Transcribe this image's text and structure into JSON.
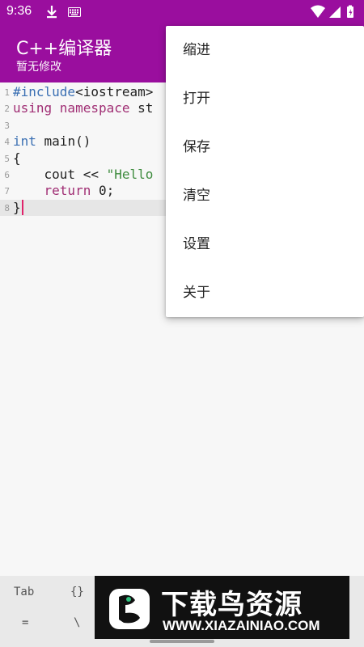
{
  "status_bar": {
    "time": "9:36",
    "icons": [
      "download-icon",
      "keyboard-icon",
      "wifi-icon",
      "cell-signal-icon",
      "battery-icon"
    ],
    "color": "#9a0e9e"
  },
  "app_bar": {
    "title": "C++编译器",
    "subtitle": "暂无修改"
  },
  "editor": {
    "lines": [
      {
        "num": "1",
        "parts": [
          {
            "t": "#include",
            "c": "kw-blue"
          },
          {
            "t": "<iostream>",
            "c": ""
          }
        ]
      },
      {
        "num": "2",
        "parts": [
          {
            "t": "using namespace",
            "c": "kw-purple"
          },
          {
            "t": " st",
            "c": ""
          }
        ]
      },
      {
        "num": "3",
        "parts": []
      },
      {
        "num": "4",
        "parts": [
          {
            "t": "int",
            "c": "kw-blue"
          },
          {
            "t": " main()",
            "c": ""
          }
        ]
      },
      {
        "num": "5",
        "parts": [
          {
            "t": "{",
            "c": ""
          }
        ]
      },
      {
        "num": "6",
        "parts": [
          {
            "t": "    cout << ",
            "c": ""
          },
          {
            "t": "\"Hello",
            "c": "str-green"
          }
        ]
      },
      {
        "num": "7",
        "parts": [
          {
            "t": "    ",
            "c": ""
          },
          {
            "t": "return",
            "c": "kw-purple"
          },
          {
            "t": " 0;",
            "c": ""
          }
        ]
      },
      {
        "num": "8",
        "parts": [
          {
            "t": "}",
            "c": ""
          }
        ],
        "current": true
      }
    ]
  },
  "menu": {
    "items": [
      "缩进",
      "打开",
      "保存",
      "清空",
      "设置",
      "关于"
    ]
  },
  "keybar": {
    "keys_row1": [
      "Tab",
      "{}"
    ],
    "keys_row2": [
      "=",
      "\\"
    ]
  },
  "watermark": {
    "title": "下载鸟资源",
    "url": "WWW.XIAZAINIAO.COM"
  }
}
